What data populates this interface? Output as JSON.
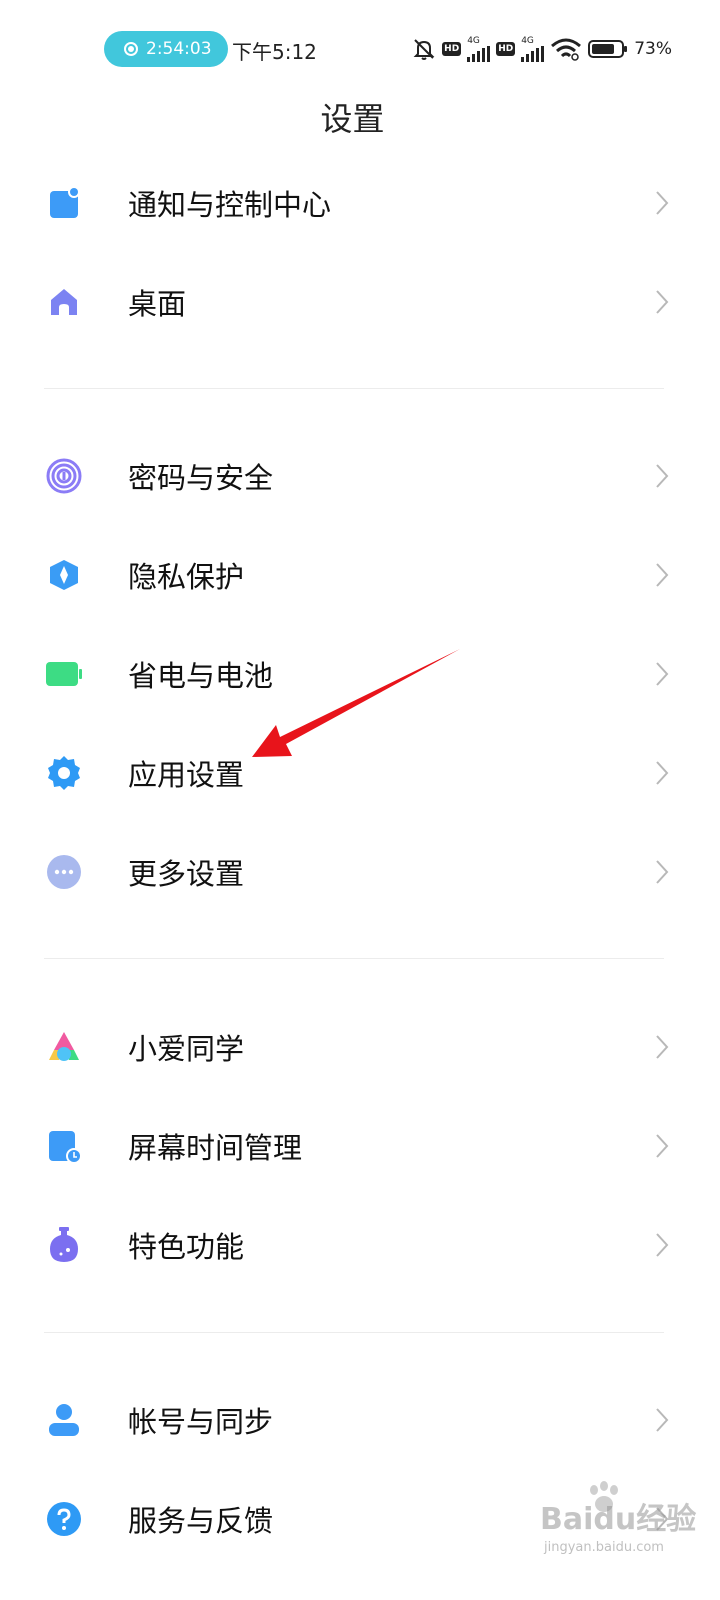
{
  "status_bar": {
    "recording_time": "2:54:03",
    "clock": "下午5:12",
    "hd_label": "HD",
    "network_type": "4G",
    "battery_percent": "73%"
  },
  "page": {
    "title": "设置"
  },
  "settings": {
    "items": [
      {
        "label": "通知与控制中心",
        "icon": "notification-icon",
        "color": "#3d9bf7"
      },
      {
        "label": "桌面",
        "icon": "home-icon",
        "color": "#7c83f2"
      },
      {
        "label": "密码与安全",
        "icon": "fingerprint-icon",
        "color": "#8b7cf6"
      },
      {
        "label": "隐私保护",
        "icon": "privacy-shield-icon",
        "color": "#3a9cf5"
      },
      {
        "label": "省电与电池",
        "icon": "battery-icon",
        "color": "#3ddc84"
      },
      {
        "label": "应用设置",
        "icon": "gear-icon",
        "color": "#2e9af5"
      },
      {
        "label": "更多设置",
        "icon": "more-dots-icon",
        "color": "#a9b9ee"
      },
      {
        "label": "小爱同学",
        "icon": "xiaoai-icon",
        "color": "#f05aa0"
      },
      {
        "label": "屏幕时间管理",
        "icon": "screen-time-icon",
        "color": "#3d9bf7"
      },
      {
        "label": "特色功能",
        "icon": "features-icon",
        "color": "#7b6ff0"
      },
      {
        "label": "帐号与同步",
        "icon": "account-icon",
        "color": "#3d9bf7"
      },
      {
        "label": "服务与反馈",
        "icon": "help-icon",
        "color": "#2e9af5"
      }
    ]
  },
  "watermark": {
    "main": "Baidu经验",
    "sub": "jingyan.baidu.com"
  },
  "colors": {
    "accent": "#41c7dc",
    "annotation": "#e8141b",
    "chevron": "#b8b8b8"
  }
}
